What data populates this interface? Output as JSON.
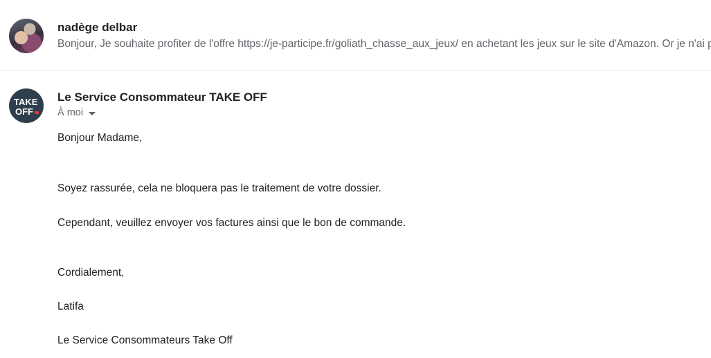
{
  "messages": [
    {
      "sender": "nadège delbar",
      "snippet": "Bonjour, Je souhaite profiter de l'offre https://je-participe.fr/goliath_chasse_aux_jeux/ en achetant les jeux sur le site d'Amazon. Or je n'ai pas de facture, seulement",
      "avatar": "profile-photo"
    },
    {
      "sender": "Le Service Consommateur TAKE OFF",
      "recipient": "À moi",
      "avatar": "take-off-logo",
      "logo_text": [
        "TAKE",
        "OFF"
      ],
      "body": [
        "Bonjour Madame,",
        "Soyez rassurée, cela ne bloquera pas le traitement de votre dossier.",
        "Cependant, veuillez envoyer vos factures ainsi que le bon de commande.",
        "Cordialement,",
        "Latifa",
        "Le Service Consommateurs Take Off"
      ]
    }
  ],
  "colors": {
    "logo_background": "#2f3e4d",
    "logo_accent": "#e53935",
    "divider": "#e6e6e6"
  }
}
